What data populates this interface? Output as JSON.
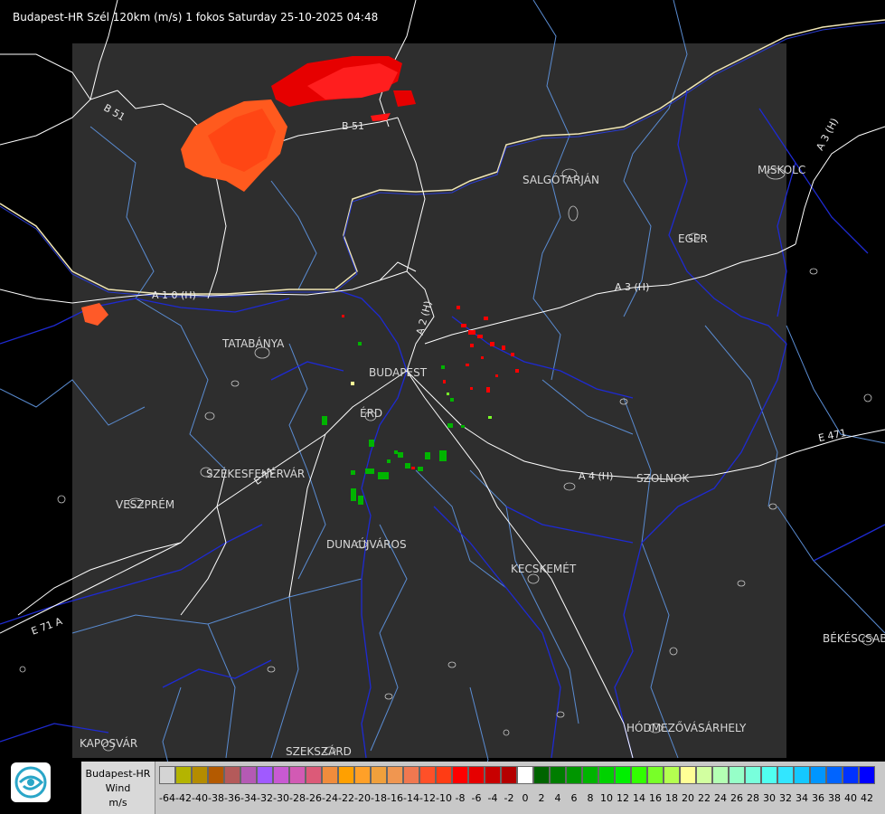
{
  "title": "Budapest-HR Szél 120km (m/s) 1 fokos Saturday 25-10-2025 04:48",
  "cities": [
    {
      "name": "SALGÓTARJÁN"
    },
    {
      "name": "MISKOLC"
    },
    {
      "name": "EGER"
    },
    {
      "name": "TATABÁNYA"
    },
    {
      "name": "BUDAPEST"
    },
    {
      "name": "ÉRD"
    },
    {
      "name": "SZÉKESFEHÉRVÁR"
    },
    {
      "name": "VESZPRÉM"
    },
    {
      "name": "DUNAÚJVÁROS"
    },
    {
      "name": "KECSKEMÉT"
    },
    {
      "name": "SZOLNOK"
    },
    {
      "name": "BÉKÉSCSABA"
    },
    {
      "name": "HÓDMEZŐVÁSÁRHELY"
    },
    {
      "name": "KAPOSVÁR"
    },
    {
      "name": "SZEKSZÁRD"
    }
  ],
  "roads": [
    {
      "name": "B 51"
    },
    {
      "name": "B 51"
    },
    {
      "name": "A 3 (H)"
    },
    {
      "name": "A 3 (H)"
    },
    {
      "name": "A 1 0 (H)"
    },
    {
      "name": "A 2 (H)"
    },
    {
      "name": "A 4 (H)"
    },
    {
      "name": "E 471"
    },
    {
      "name": "E 71"
    },
    {
      "name": "E 71 A"
    }
  ],
  "legend": {
    "radar": "Budapest-HR",
    "quantity": "Wind",
    "unit": "m/s",
    "bins": [
      {
        "label": "-64",
        "color": "#d4d4d4"
      },
      {
        "label": "-42",
        "color": "#b4b400"
      },
      {
        "label": "-40",
        "color": "#b48c00"
      },
      {
        "label": "-38",
        "color": "#b45a00"
      },
      {
        "label": "-36",
        "color": "#b45a5a"
      },
      {
        "label": "-34",
        "color": "#b45ab4"
      },
      {
        "label": "-32",
        "color": "#a05aff"
      },
      {
        "label": "-30",
        "color": "#c85ad2"
      },
      {
        "label": "-28",
        "color": "#d25ab4"
      },
      {
        "label": "-26",
        "color": "#dc5a78"
      },
      {
        "label": "-24",
        "color": "#f08c3c"
      },
      {
        "label": "-22",
        "color": "#ffa000"
      },
      {
        "label": "-20",
        "color": "#ffa028"
      },
      {
        "label": "-18",
        "color": "#f0a03c"
      },
      {
        "label": "-16",
        "color": "#f09650"
      },
      {
        "label": "-14",
        "color": "#f07850"
      },
      {
        "label": "-12",
        "color": "#ff5028"
      },
      {
        "label": "-10",
        "color": "#ff3c14"
      },
      {
        "label": "-8",
        "color": "#ff0000"
      },
      {
        "label": "-6",
        "color": "#e60000"
      },
      {
        "label": "-4",
        "color": "#c80000"
      },
      {
        "label": "-2",
        "color": "#b40000"
      },
      {
        "label": "0",
        "color": "#ffffff"
      },
      {
        "label": "2",
        "color": "#006400"
      },
      {
        "label": "4",
        "color": "#007d00"
      },
      {
        "label": "6",
        "color": "#009600"
      },
      {
        "label": "8",
        "color": "#00b400"
      },
      {
        "label": "10",
        "color": "#00d200"
      },
      {
        "label": "12",
        "color": "#00f000"
      },
      {
        "label": "14",
        "color": "#32ff00"
      },
      {
        "label": "16",
        "color": "#78ff28"
      },
      {
        "label": "18",
        "color": "#b4ff50"
      },
      {
        "label": "20",
        "color": "#ffff96"
      },
      {
        "label": "22",
        "color": "#d2ffa0"
      },
      {
        "label": "24",
        "color": "#b4ffb4"
      },
      {
        "label": "26",
        "color": "#96ffc8"
      },
      {
        "label": "28",
        "color": "#78ffdc"
      },
      {
        "label": "30",
        "color": "#50fff0"
      },
      {
        "label": "32",
        "color": "#32e6ff"
      },
      {
        "label": "34",
        "color": "#14c8ff"
      },
      {
        "label": "36",
        "color": "#0096ff"
      },
      {
        "label": "38",
        "color": "#0064ff"
      },
      {
        "label": "40",
        "color": "#0032ff"
      },
      {
        "label": "42",
        "color": "#0000ff"
      }
    ]
  },
  "colors": {
    "background": "#000000",
    "radar_area": "#2e2e2e",
    "roads": "#ffffff",
    "rivers": "#1e2ad2",
    "borders": "#5a8cd2",
    "country_border": "#f0e6b4"
  },
  "icons": {
    "logo": "omsz-logo-icon"
  }
}
